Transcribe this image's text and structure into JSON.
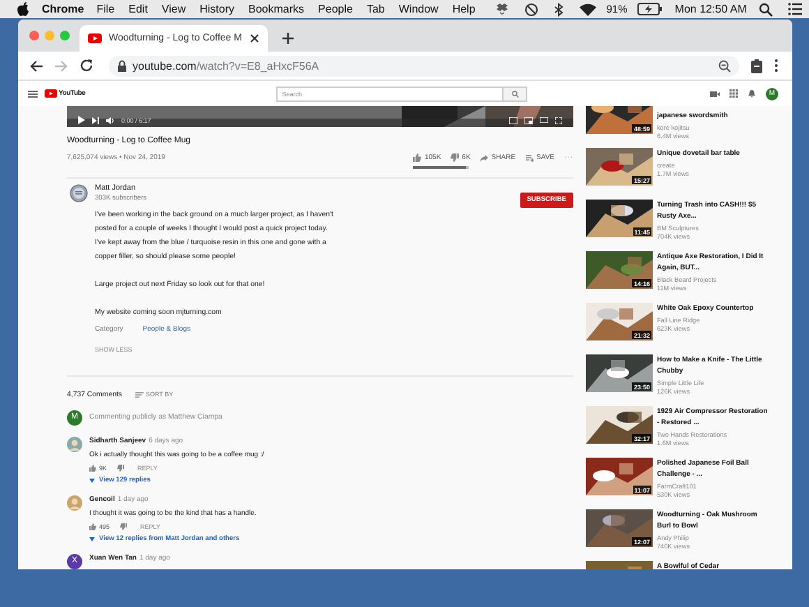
{
  "menubar": {
    "app": "Chrome",
    "menus": [
      "File",
      "Edit",
      "View",
      "History",
      "Bookmarks",
      "People",
      "Tab",
      "Window",
      "Help"
    ],
    "battery": "91%",
    "clock": "Mon 12:50 AM"
  },
  "browser": {
    "tab_title": "Woodturning - Log to Coffee M",
    "url_host": "youtube.com",
    "url_path": "/watch?v=E8_aHxcF56A",
    "forward_disabled": true
  },
  "youtube_header": {
    "logo": "YouTube",
    "search_placeholder": "Search",
    "avatar": "M"
  },
  "player": {
    "time": "0:00 / 6:17"
  },
  "video": {
    "title": "Woodturning - Log to Coffee Mug",
    "meta": "7,625,074 views • Nov 24, 2019",
    "likes": "105K",
    "dislikes": "6K",
    "share": "SHARE",
    "save": "SAVE",
    "more": "···",
    "like_ratio": {
      "level": 0.95
    }
  },
  "channel": {
    "name": "Matt Jordan",
    "subscribers": "303K subscribers",
    "subscribe": "SUBSCRIBE"
  },
  "description": {
    "paragraphs": [
      "I've been working in the back ground on a much larger project, as I haven't posted for a couple of weeks I thought I would post a quick project today. I've kept away from the blue / turquoise resin in this one and gone with a copper filler, so should please some people!",
      "Large project out next Friday so look out for that one!",
      "My website coming soon mjturning.com"
    ],
    "category_label": "Category",
    "category": "People & Blogs",
    "show_less": "SHOW LESS"
  },
  "comments": {
    "count": "4,737 Comments",
    "sort": "SORT BY",
    "avatar": "M",
    "commenting_as": "Commenting publicly as Matthew Ciampa",
    "items": [
      {
        "author": "Sidharth Sanjeev",
        "time": "6 days ago",
        "text": "Ok i actually thought this was going to be a coffee mug :/",
        "likes": "9K",
        "reply": "REPLY",
        "replies": "View 129 replies"
      },
      {
        "author": "Gencoil",
        "time": "1 day ago",
        "text": "I thought it was going to be the kind that has a handle.",
        "likes": "495",
        "reply": "REPLY",
        "replies": "View 12 replies from Matt Jordan and others"
      },
      {
        "author": "Xuan Wen Tan",
        "time": "1 day ago",
        "avatar": "X"
      }
    ]
  },
  "sidebar": {
    "items": [
      {
        "title": "japanese swordsmith",
        "channel": "kore kojitsu",
        "views": "6.4M views",
        "duration": "48:59"
      },
      {
        "title": "Unique dovetail bar table",
        "channel": "create",
        "views": "1.7M views",
        "duration": "15:27"
      },
      {
        "title": "Turning Trash into CASH!!! $5 Rusty Axe...",
        "channel": "BM Sculptures",
        "views": "704K views",
        "duration": "11:45"
      },
      {
        "title": "Antique Axe Restoration, I Did It Again, BUT...",
        "channel": "Black Beard Projects",
        "views": "11M views",
        "duration": "14:16"
      },
      {
        "title": "White Oak Epoxy Countertop",
        "channel": "Fall Line Ridge",
        "views": "623K views",
        "duration": "21:32"
      },
      {
        "title": "How to Make a Knife - The Little Chubby",
        "channel": "Simple Little Life",
        "views": "126K views",
        "duration": "23:50"
      },
      {
        "title": "1929 Air Compressor Restoration - Restored ...",
        "channel": "Two Hands Restorations",
        "views": "1.6M views",
        "duration": "32:17"
      },
      {
        "title": "Polished Japanese Foil Ball Challenge - ...",
        "channel": "FarmCraft101",
        "views": "530K views",
        "duration": "11:07"
      },
      {
        "title": "Woodturning - Oak Mushroom Burl to Bowl",
        "channel": "Andy Philip",
        "views": "740K views",
        "duration": "12:07"
      },
      {
        "title": "A Bowlful of Cedar"
      }
    ]
  }
}
